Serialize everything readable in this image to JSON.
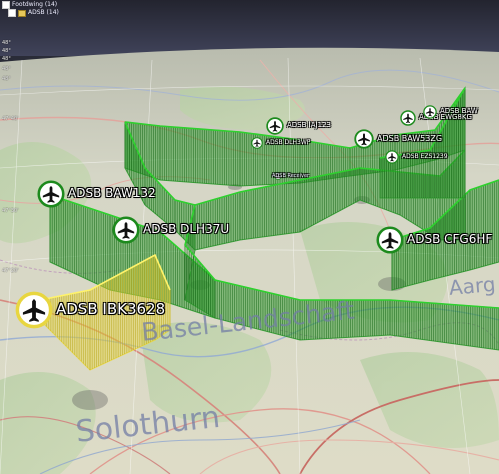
{
  "layer_tree": {
    "items": [
      {
        "label": "Footdwing (14)",
        "kind": "root"
      },
      {
        "label": "ADSB (14)",
        "kind": "folder"
      }
    ]
  },
  "ruler_ticks": [
    "48°",
    "48°",
    "48°",
    "48°",
    "48°",
    "47°40'",
    "47°30'",
    "47°20'"
  ],
  "aircraft": [
    {
      "label": "ADSB IBK3628",
      "style": "selected"
    },
    {
      "label": "ADSB BAW132",
      "style": "normal"
    },
    {
      "label": "ADSB DLH37U",
      "style": "normal"
    },
    {
      "label": "ADSB CFG6HF",
      "style": "normal"
    },
    {
      "label": "ADSB BAW53ZG",
      "style": "normal"
    },
    {
      "label": "ADSB EZS1239",
      "style": "normal"
    },
    {
      "label": "ADSB IAJ123",
      "style": "normal"
    },
    {
      "label": "ADSB DLH3WP",
      "style": "normal"
    },
    {
      "label": "ADSB EWG8KG",
      "style": "normal"
    },
    {
      "label": "ADSB BAW",
      "style": "normal"
    },
    {
      "label": "ADSB Receiver",
      "style": "receiver"
    }
  ],
  "map_labels": {
    "basel": "Basel-Landschaft",
    "solothurn": "Solothurn",
    "aargau": "Aarg"
  },
  "colors": {
    "sky": "#2b2d3b",
    "terrain": "#d9d9c4",
    "curtain": "#2f9b2f",
    "curtain_selected": "#e8d640"
  }
}
